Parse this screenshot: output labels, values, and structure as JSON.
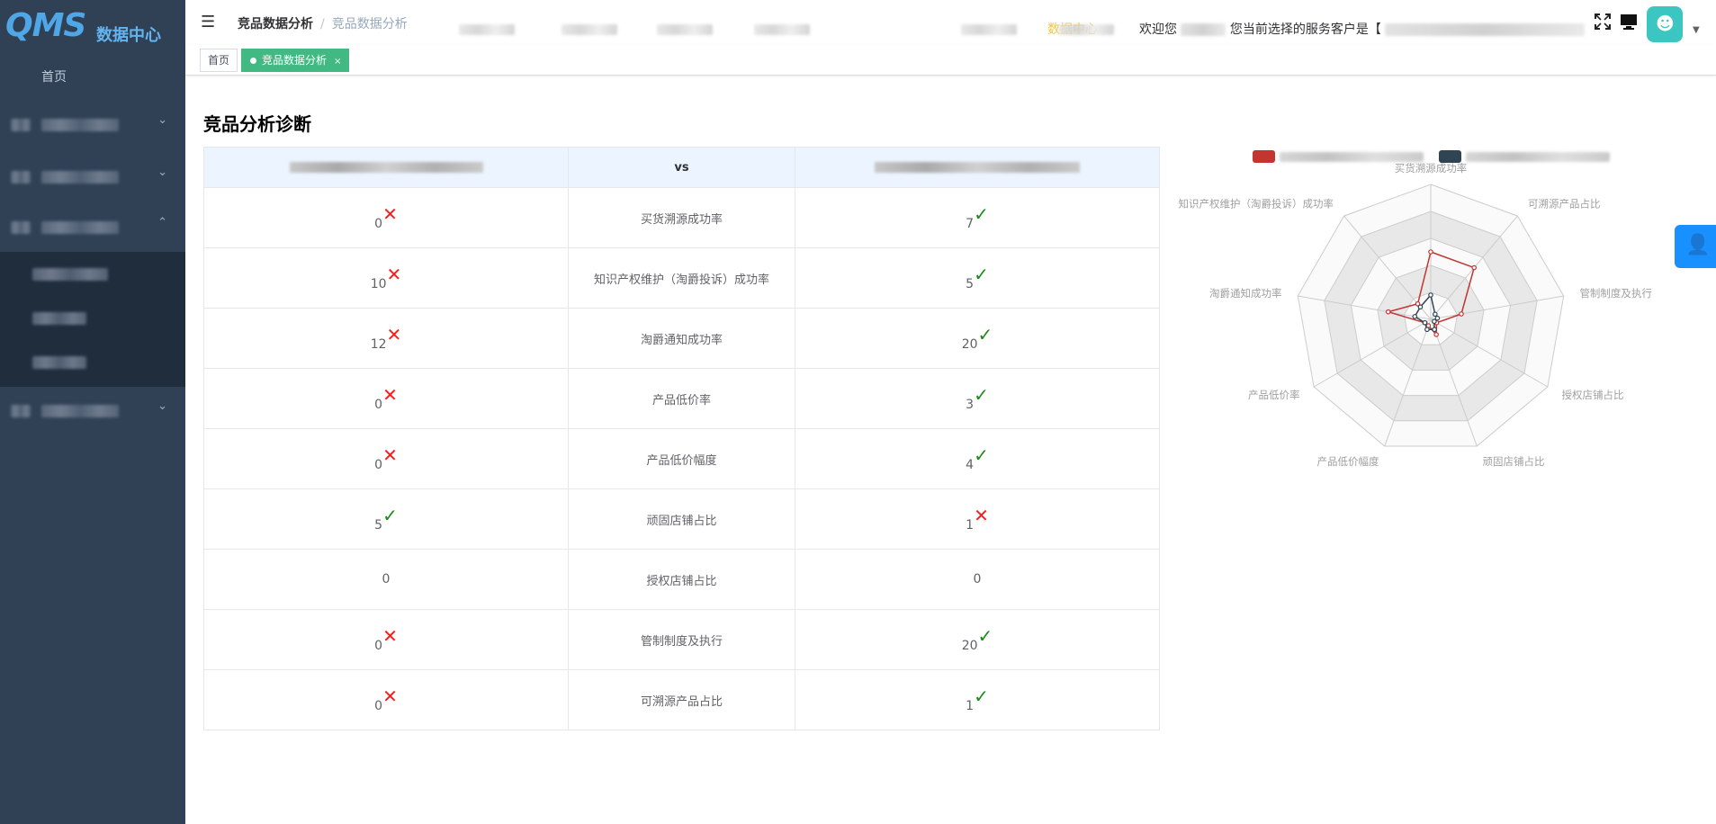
{
  "app": {
    "logo_mark": "QMS",
    "logo_text": "数据中心"
  },
  "sidebar": {
    "home": "首页",
    "groups_chevrons": [
      "⌄",
      "⌄",
      "⌃",
      "⌄"
    ]
  },
  "header": {
    "breadcrumb": [
      "竞品数据分析",
      "竞品数据分析"
    ],
    "breadcrumb_sep": "/",
    "active_nav": "数据中心",
    "welcome_prefix": "欢迎您",
    "customer_prefix": "您当前选择的服务客户是【"
  },
  "tags": {
    "home": "首页",
    "active": "竞品数据分析",
    "close": "×"
  },
  "page": {
    "title": "竞品分析诊断"
  },
  "table": {
    "vs_label": "vs",
    "rows": [
      {
        "metric": "买货溯源成功率",
        "left": "0",
        "left_ok": false,
        "right": "7",
        "right_ok": true
      },
      {
        "metric": "知识产权维护（淘爵投诉）成功率",
        "left": "10",
        "left_ok": false,
        "right": "5",
        "right_ok": true
      },
      {
        "metric": "淘爵通知成功率",
        "left": "12",
        "left_ok": false,
        "right": "20",
        "right_ok": true
      },
      {
        "metric": "产品低价率",
        "left": "0",
        "left_ok": false,
        "right": "3",
        "right_ok": true
      },
      {
        "metric": "产品低价幅度",
        "left": "0",
        "left_ok": false,
        "right": "4",
        "right_ok": true
      },
      {
        "metric": "顽固店铺占比",
        "left": "5",
        "left_ok": true,
        "right": "1",
        "right_ok": false
      },
      {
        "metric": "授权店铺占比",
        "left": "0",
        "left_ok": null,
        "right": "0",
        "right_ok": null
      },
      {
        "metric": "管制制度及执行",
        "left": "0",
        "left_ok": false,
        "right": "20",
        "right_ok": true
      },
      {
        "metric": "可溯源产品占比",
        "left": "0",
        "left_ok": false,
        "right": "1",
        "right_ok": true
      }
    ]
  },
  "radar": {
    "axes": [
      "买货溯源成功率",
      "可溯源产品占比",
      "管制制度及执行",
      "授权店铺占比",
      "顽固店铺占比",
      "产品低价幅度",
      "产品低价率",
      "淘爵通知成功率",
      "知识产权维护（淘爵投诉）成功率"
    ],
    "series_colors": [
      "#c23531",
      "#2f4554"
    ],
    "series": [
      {
        "values": [
          0.5,
          0.5,
          0.23,
          0.05,
          0.12,
          0.05,
          0.05,
          0.32,
          0.15
        ]
      },
      {
        "values": [
          0.18,
          0.05,
          0.05,
          0.03,
          0.08,
          0.08,
          0.05,
          0.12,
          0.12
        ]
      }
    ]
  },
  "icons": {
    "menu": "hamburger-icon",
    "fullscreen": "fullscreen-icon",
    "screen": "monitor-icon",
    "avatar": "avatar-icon",
    "float": "user-icon"
  }
}
